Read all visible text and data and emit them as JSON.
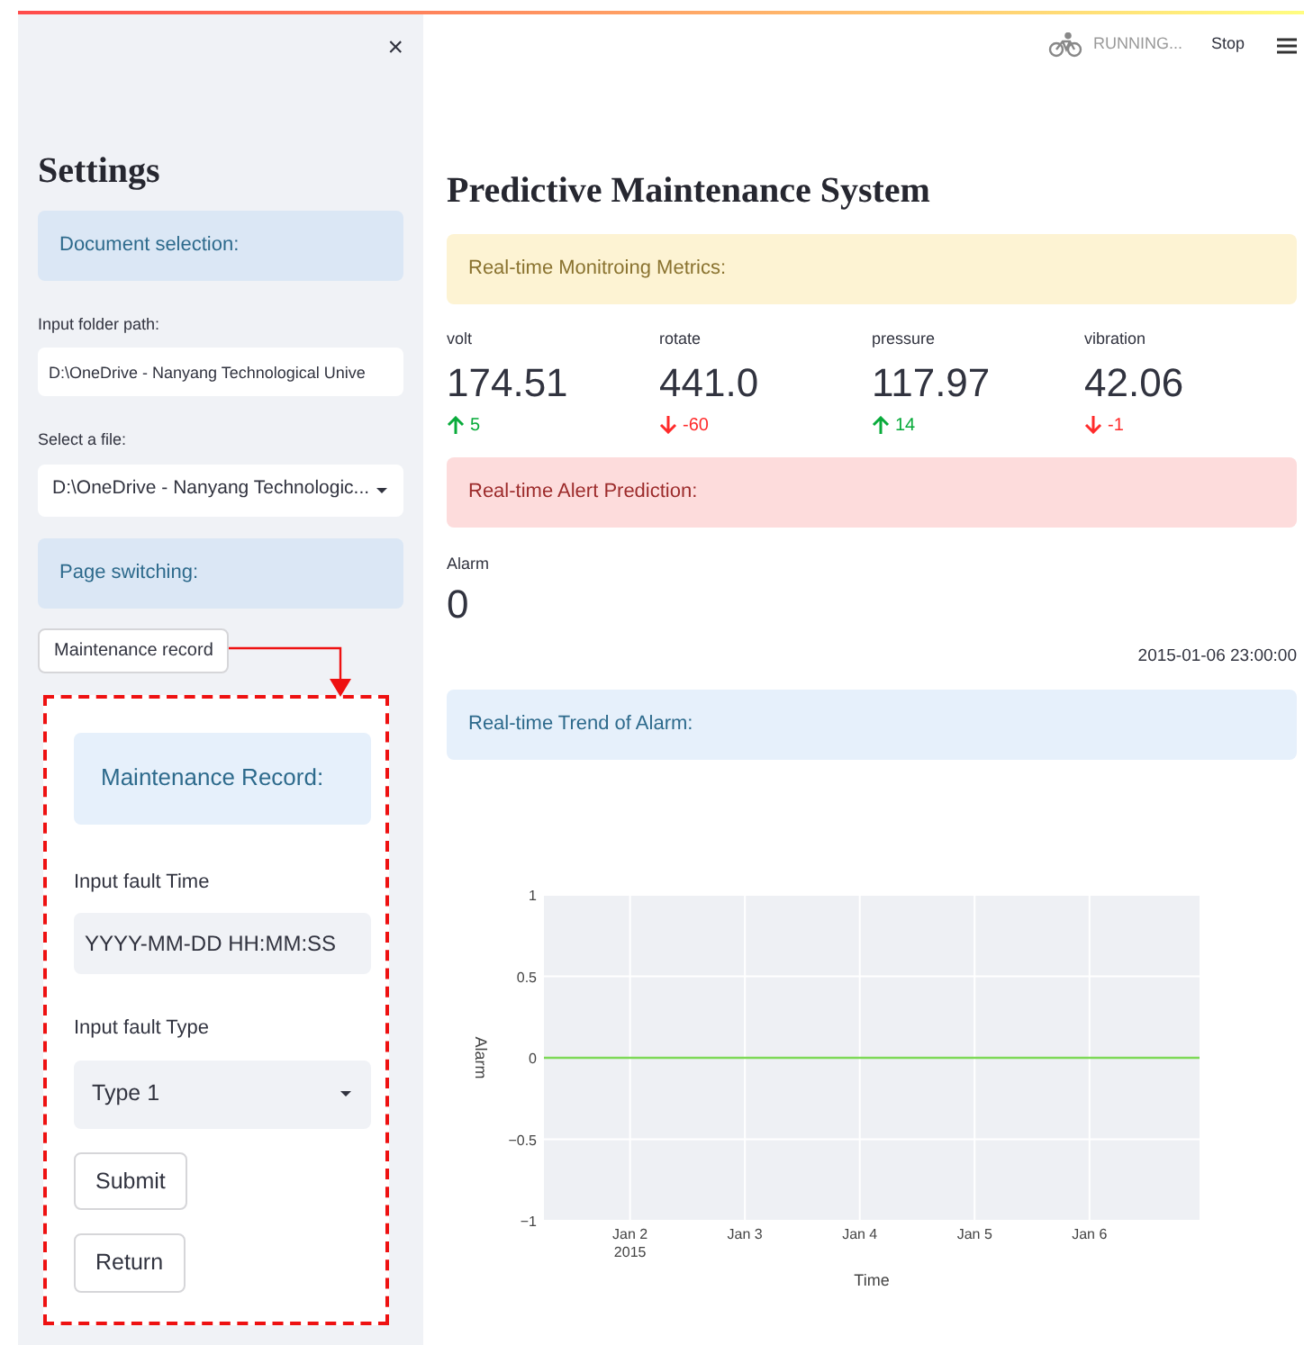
{
  "sidebar": {
    "close": "×",
    "title": "Settings",
    "sections": [
      {
        "kind": "info",
        "text": "Document selection:"
      },
      {
        "kind": "label",
        "text": "Input folder path:"
      },
      {
        "kind": "input",
        "value": "D:\\OneDrive - Nanyang Technological Unive"
      },
      {
        "kind": "label",
        "text": "Select a file:"
      },
      {
        "kind": "select",
        "value": "D:\\OneDrive - Nanyang Technologic..."
      },
      {
        "kind": "info",
        "text": "Page switching:"
      },
      {
        "kind": "button",
        "text": "Maintenance record"
      }
    ],
    "record_panel": {
      "title": "Maintenance Record:",
      "items": [
        {
          "kind": "label",
          "text": "Input fault Time"
        },
        {
          "kind": "input",
          "placeholder": "YYYY-MM-DD HH:MM:SS"
        },
        {
          "kind": "label",
          "text": "Input fault Type"
        },
        {
          "kind": "select",
          "value": "Type 1"
        },
        {
          "kind": "button",
          "text": "Submit"
        },
        {
          "kind": "button",
          "text": "Return"
        }
      ]
    }
  },
  "toolbar": {
    "status": "RUNNING...",
    "stop": "Stop"
  },
  "main": {
    "title": "Predictive Maintenance System",
    "metrics_banner": {
      "kind": "warning",
      "text": "Real-time Monitroing Metrics:"
    },
    "metrics": [
      {
        "label": "volt",
        "value": "174.51",
        "delta": "5",
        "increase": true
      },
      {
        "label": "rotate",
        "value": "441.0",
        "delta": "-60",
        "increase": false
      },
      {
        "label": "pressure",
        "value": "117.97",
        "delta": "14",
        "increase": true
      },
      {
        "label": "vibration",
        "value": "42.06",
        "delta": "-1",
        "increase": false
      }
    ],
    "alert_banner": {
      "kind": "danger",
      "text": "Real-time Alert Prediction:"
    },
    "alarm": {
      "label": "Alarm",
      "value": "0"
    },
    "timestamp": "2015-01-06 23:00:00",
    "trend_banner": {
      "kind": "info",
      "text": "Real-time Trend of Alarm:"
    },
    "chart_data": {
      "type": "line",
      "xlabel": "Time",
      "ylabel": "Alarm",
      "x": [
        "2015-01-01T06:00",
        "2015-01-06T23:00"
      ],
      "series": [
        {
          "color": "#7ed957",
          "values": [
            0,
            0
          ]
        }
      ],
      "grid": true,
      "xlim": [
        "2015-01-01T06:00",
        "2015-01-06T23:00"
      ],
      "ylim": [
        -1,
        1
      ],
      "xticks": [
        {
          "value": "2015-01-02T00:00",
          "label": "Jan 2\n2015"
        },
        {
          "value": "2015-01-03T00:00",
          "label": "Jan 3"
        },
        {
          "value": "2015-01-04T00:00",
          "label": "Jan 4"
        },
        {
          "value": "2015-01-05T00:00",
          "label": "Jan 5"
        },
        {
          "value": "2015-01-06T00:00",
          "label": "Jan 6"
        }
      ],
      "yticks": [
        {
          "value": -1,
          "label": "−1"
        },
        {
          "value": -0.5,
          "label": "−0.5"
        },
        {
          "value": 0,
          "label": "0"
        },
        {
          "value": 0.5,
          "label": "0.5"
        },
        {
          "value": 1,
          "label": "1"
        }
      ]
    }
  }
}
